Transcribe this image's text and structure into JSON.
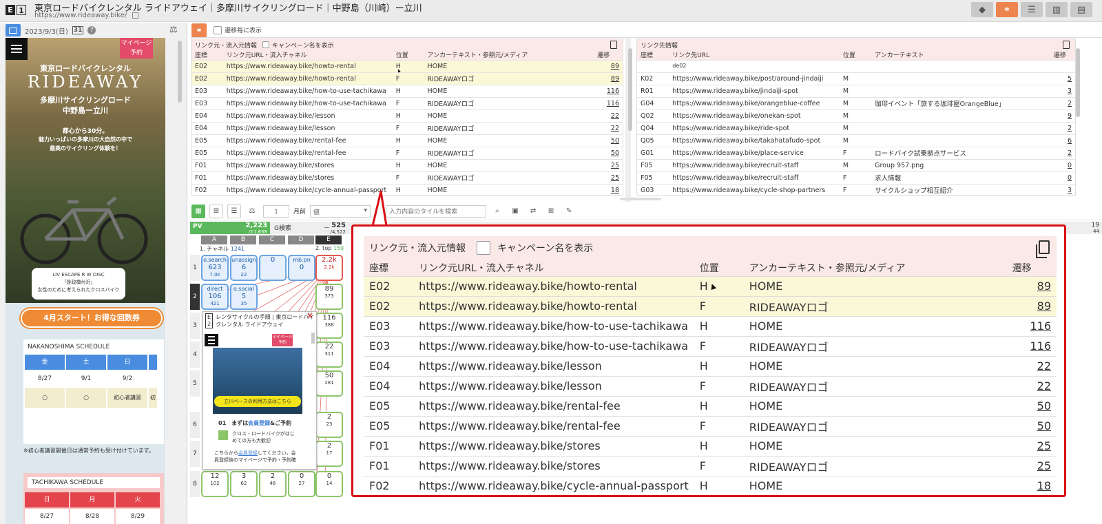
{
  "header": {
    "logo_e": "E",
    "logo_num": "1",
    "title": "東京ロードバイクレンタル ライドアウェイ｜多摩川サイクリングロード｜中野島（川崎）ー立川",
    "url": "https://www.rideaway.bike/",
    "buttons": [
      "tag-icon",
      "link-icon",
      "list-icon",
      "chart-icon",
      "table-icon"
    ]
  },
  "left": {
    "date": "2023/9/3(日)",
    "calendar_num": "31",
    "site": {
      "mypage": "マイページ",
      "reserve": "予約",
      "hero_line1": "東京ロードバイクレンタル",
      "hero_brand": "RIDEAWAY",
      "hero_line2": "多摩川サイクリングロード",
      "hero_line3": "中野島ー立川",
      "tag1": "都心から30分。",
      "tag2": "魅力いっぱいの多摩川の大自然の中で",
      "tag3": "最高のサイクリング体験を！",
      "caption1": "LIV ESCAPE R W DISC",
      "caption2": "「是政橋付近」",
      "caption3": "女性のために考えられたクロスバイク",
      "promo": "4月スタート！お得な回数券",
      "nak_title": "NAKANOSHIMA SCHEDULE",
      "nak_days": [
        "金",
        "土",
        "日"
      ],
      "nak_dates": [
        "8/27",
        "9/1",
        "9/2"
      ],
      "nak_vals": [
        "○",
        "○",
        "初心者講習",
        "初"
      ],
      "note": "※初心者講習開催日は通常予約も受け付けています。",
      "tac_title": "TACHIKAWA SCHEDULE",
      "tac_days": [
        "日",
        "月",
        "火"
      ],
      "tac_dates": [
        "8/27",
        "8/28",
        "8/29"
      ]
    }
  },
  "toolbar": {
    "show_each": "遷移毎に表示"
  },
  "source_panel": {
    "title": "リンク元・流入元情報",
    "campaign": "キャンペーン名を表示",
    "cols": [
      "座標",
      "リンク元URL・流入チャネル",
      "位置",
      "アンカーテキスト・参照元/メディア",
      "遷移"
    ],
    "rows": [
      [
        "E02",
        "https://www.rideaway.bike/howto-rental",
        "H",
        "HOME",
        "89"
      ],
      [
        "E02",
        "https://www.rideaway.bike/howto-rental",
        "F",
        "RIDEAWAYロゴ",
        "89"
      ],
      [
        "E03",
        "https://www.rideaway.bike/how-to-use-tachikawa",
        "H",
        "HOME",
        "116"
      ],
      [
        "E03",
        "https://www.rideaway.bike/how-to-use-tachikawa",
        "F",
        "RIDEAWAYロゴ",
        "116"
      ],
      [
        "E04",
        "https://www.rideaway.bike/lesson",
        "H",
        "HOME",
        "22"
      ],
      [
        "E04",
        "https://www.rideaway.bike/lesson",
        "F",
        "RIDEAWAYロゴ",
        "22"
      ],
      [
        "E05",
        "https://www.rideaway.bike/rental-fee",
        "H",
        "HOME",
        "50"
      ],
      [
        "E05",
        "https://www.rideaway.bike/rental-fee",
        "F",
        "RIDEAWAYロゴ",
        "50"
      ],
      [
        "F01",
        "https://www.rideaway.bike/stores",
        "H",
        "HOME",
        "25"
      ],
      [
        "F01",
        "https://www.rideaway.bike/stores",
        "F",
        "RIDEAWAYロゴ",
        "25"
      ],
      [
        "F02",
        "https://www.rideaway.bike/cycle-annual-passport",
        "H",
        "HOME",
        "18"
      ]
    ]
  },
  "dest_panel": {
    "title": "リンク先情報",
    "cols": [
      "座標",
      "リンク先URL",
      "位置",
      "アンカーテキスト",
      "遷移"
    ],
    "partial": "de02",
    "rows": [
      [
        "K02",
        "https://www.rideaway.bike/post/around-jindaiji",
        "M",
        "",
        "5"
      ],
      [
        "R01",
        "https://www.rideaway.bike/jindaiji-spot",
        "M",
        "",
        "3"
      ],
      [
        "G04",
        "https://www.rideaway.bike/orangeblue-coffee",
        "M",
        "珈琲イベント「旅する珈琲屋OrangeBlue」",
        "2"
      ],
      [
        "Q02",
        "https://www.rideaway.bike/onekan-spot",
        "M",
        "",
        "9"
      ],
      [
        "Q04",
        "https://www.rideaway.bike/ride-spot",
        "M",
        "",
        "2"
      ],
      [
        "Q05",
        "https://www.rideaway.bike/takahatafudo-spot",
        "M",
        "",
        "6"
      ],
      [
        "G01",
        "https://www.rideaway.bike/place-service",
        "F",
        "ロードバイク試乗拠点サービス",
        "2"
      ],
      [
        "F05",
        "https://www.rideaway.bike/recruit-staff",
        "M",
        "Group 957.png",
        "0"
      ],
      [
        "F05",
        "https://www.rideaway.bike/recruit-staff",
        "F",
        "求人情報",
        "0"
      ],
      [
        "G03",
        "https://www.rideaway.bike/cycle-shop-partners",
        "F",
        "サイクルショップ相互紹介",
        "3"
      ]
    ]
  },
  "grid": {
    "period_value": "1",
    "period_label": "月前",
    "metric": "値",
    "search_placeholder": "入力内容のタイルを検索",
    "pv_label": "PV",
    "pv_value": "2,223",
    "pv_total": "/11,638",
    "g_label": "G検索",
    "g_dash": "－",
    "g_value": "525",
    "g_total": "/4,522",
    "right_num": "19",
    "right_num2": "44",
    "cols": [
      "A",
      "B",
      "C",
      "D",
      "E"
    ],
    "rows": [
      "1",
      "2",
      "3",
      "4",
      "5",
      "6",
      "7",
      "8"
    ],
    "channel_label": "1. チャネル",
    "channel_num": "1241",
    "top_label": "2. top",
    "top_num": "159",
    "cells": {
      "a1": [
        "o.search",
        "623",
        "7.0k"
      ],
      "b1": [
        "unassign",
        "6",
        "22"
      ],
      "c1": [
        "",
        "0",
        ""
      ],
      "d1": [
        "mb.pn",
        "0",
        ""
      ],
      "e1": [
        "",
        "2.2k",
        "2.2k"
      ],
      "a2": [
        "direct",
        "106",
        "421"
      ],
      "b2": [
        "o.social",
        "5",
        "35"
      ],
      "e2": [
        "",
        "89",
        "373"
      ],
      "e3": [
        "",
        "116",
        "388"
      ],
      "e4": [
        "",
        "22",
        "311"
      ],
      "e5": [
        "",
        "50",
        "281"
      ],
      "e6": [
        "",
        "2",
        "23"
      ],
      "e7": [
        "",
        "2",
        "17"
      ],
      "a8": [
        "",
        "12",
        "102"
      ],
      "b8": [
        "",
        "3",
        "62"
      ],
      "c8": [
        "",
        "2",
        "46"
      ],
      "d8": [
        "",
        "0",
        "27"
      ],
      "e8": [
        "",
        "0",
        "14"
      ]
    }
  },
  "popup": {
    "badge_top": "E",
    "badge_bot": "2",
    "title": "レンタサイクルの手順 | 東京ロードバイクレンタル ライドアウェイ",
    "close": "×",
    "mypage": "マイページ",
    "reserve": "予約",
    "yellow": "立川ベースの利用方法はこちら",
    "step_no": "01",
    "step_pre": "まずは",
    "step_link": "会員登録",
    "step_post": "&ご予約",
    "sub1": "クロス・ロードバイクがはじめての方も大歓迎",
    "body_pre": "こちらから",
    "body_link": "会員登録",
    "body_post": "してください。会員登録後のマイページで予約・予約確"
  }
}
